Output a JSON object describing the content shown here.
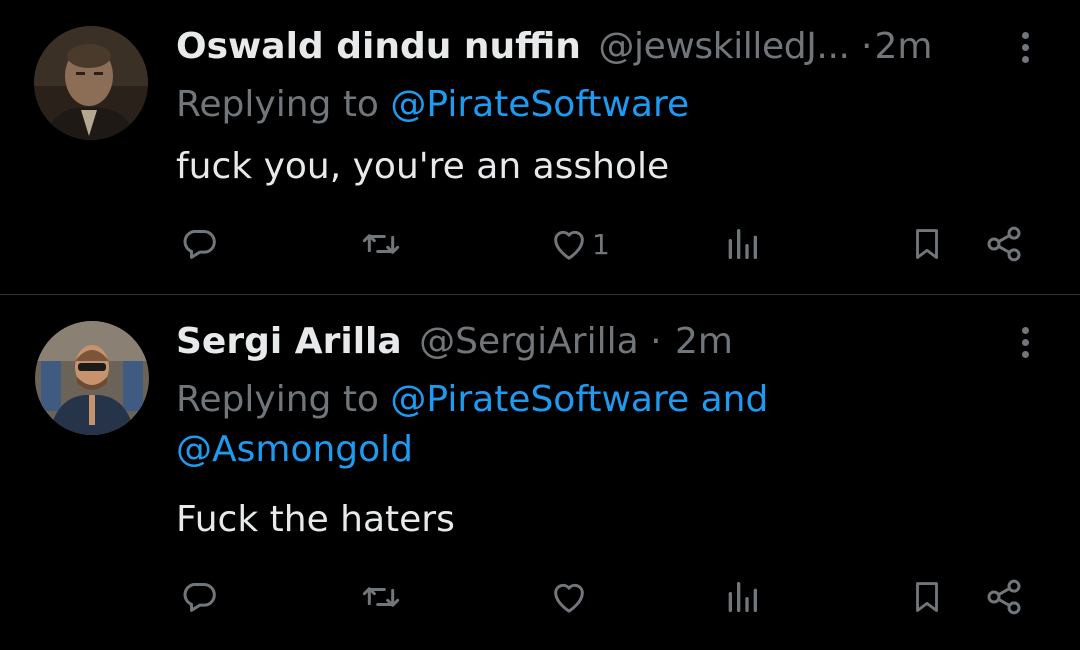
{
  "tweets": [
    {
      "display_name": "Oswald dindu nuffin",
      "handle": "@jewskilledJ...",
      "separator": "·",
      "time": "2m",
      "replying_prefix": "Replying to ",
      "replying_mentions": "@PirateSoftware",
      "replying_second_line": "",
      "text": "fuck you, you're an asshole",
      "like_count": "1"
    },
    {
      "display_name": "Sergi Arilla",
      "handle": "@SergiArilla",
      "separator": "·",
      "time": "2m",
      "replying_prefix": "Replying to ",
      "replying_mentions": "@PirateSoftware and",
      "replying_second_line": "@Asmongold",
      "text": "Fuck the haters",
      "like_count": ""
    }
  ],
  "colors": {
    "background": "#000000",
    "text_primary": "#e7e9ea",
    "text_secondary": "#71767b",
    "mention": "#1d9bf0",
    "divider": "#2f3336"
  },
  "icons": [
    "reply-icon",
    "retweet-icon",
    "like-icon",
    "views-icon",
    "bookmark-icon",
    "share-icon",
    "more-icon"
  ]
}
